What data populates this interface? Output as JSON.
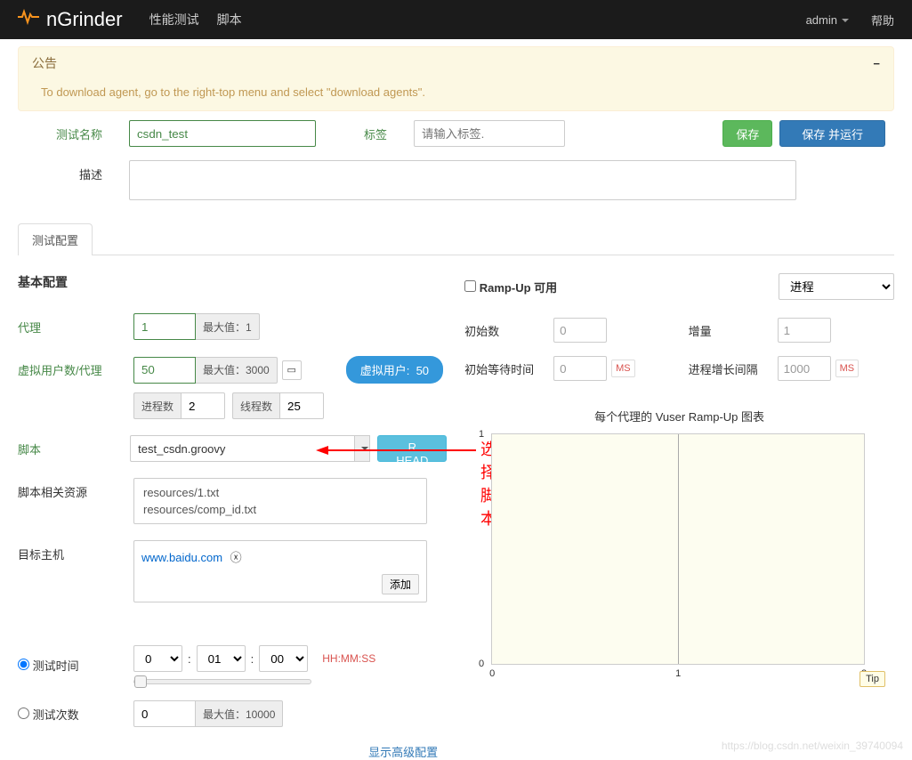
{
  "nav": {
    "brand": "nGrinder",
    "perf_test": "性能测试",
    "script": "脚本",
    "user": "admin",
    "help": "帮助"
  },
  "alert": {
    "title": "公告",
    "body": "To download agent, go to the right-top menu and select \"download agents\"."
  },
  "form": {
    "test_name_label": "测试名称",
    "test_name_value": "csdn_test",
    "tag_label": "标签",
    "tag_placeholder": "请输入标签.",
    "save": "保存",
    "save_run": "保存 并运行",
    "desc_label": "描述"
  },
  "tabs": {
    "config": "测试配置"
  },
  "basic": {
    "title": "基本配置",
    "agent_label": "代理",
    "agent_value": "1",
    "agent_max": "最大值：1",
    "vuser_label": "虚拟用户数/代理",
    "vuser_value": "50",
    "vuser_max": "最大值：3000",
    "process_label": "进程数",
    "process_value": "2",
    "thread_label": "线程数",
    "thread_value": "25",
    "vuser_badge_label": "虚拟用户:",
    "vuser_badge_value": "50",
    "script_label": "脚本",
    "script_value": "test_csdn.groovy",
    "script_btn": "R HEAD",
    "resources_label": "脚本相关资源",
    "resources": [
      "resources/1.txt",
      "resources/comp_id.txt"
    ],
    "host_label": "目标主机",
    "host_value": "www.baidu.com",
    "host_add": "添加",
    "duration_label": "测试时间",
    "duration_h": "0",
    "duration_m": "01",
    "duration_s": "00",
    "duration_hint": "HH:MM:SS",
    "count_label": "测试次数",
    "count_value": "0",
    "count_max": "最大值：10000",
    "advanced": "显示高级配置"
  },
  "rampup": {
    "checkbox_label": "Ramp-Up 可用",
    "type_value": "进程",
    "init_label": "初始数",
    "init_value": "0",
    "incr_label": "增量",
    "incr_value": "1",
    "wait_label": "初始等待时间",
    "wait_value": "0",
    "interval_label": "进程增长间隔",
    "interval_value": "1000",
    "ms": "MS"
  },
  "chart_data": {
    "type": "line",
    "title": "每个代理的 Vuser Ramp-Up 图表",
    "x": [
      0,
      1,
      2
    ],
    "ylim": [
      0,
      1
    ],
    "xlabel": "",
    "ylabel": "",
    "tip": "Tip"
  },
  "annotation": "选择脚本",
  "watermark": "https://blog.csdn.net/weixin_39740094"
}
